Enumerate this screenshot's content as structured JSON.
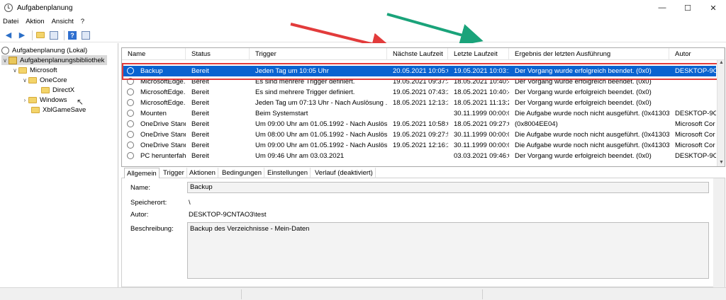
{
  "window": {
    "title": "Aufgabenplanung",
    "controls": [
      "—",
      "☐",
      "✕"
    ]
  },
  "menu": {
    "items": [
      "Datei",
      "Aktion",
      "Ansicht",
      "?"
    ]
  },
  "tree": {
    "items": [
      {
        "label": "Aufgabenplanung (Lokal)",
        "level": 0
      },
      {
        "label": "Aufgabenplanungsbibliothek",
        "level": 0
      },
      {
        "label": "Microsoft",
        "level": 1
      },
      {
        "label": "OneCore",
        "level": 2
      },
      {
        "label": "DirectX",
        "level": 3
      },
      {
        "label": "Windows",
        "level": 2
      },
      {
        "label": "XblGameSave",
        "level": 2
      }
    ]
  },
  "table": {
    "columns": [
      "Name",
      "Status",
      "Trigger",
      "Nächste Laufzeit",
      "Letzte Laufzeit",
      "Ergebnis der letzten Ausführung",
      "Autor"
    ],
    "rows": [
      [
        "Backup",
        "Bereit",
        "Jeden Tag um 10:05 Uhr",
        "20.05.2021 10:05:00",
        "19.05.2021 10:03:12",
        "Der Vorgang wurde erfolgreich beendet. (0x0)",
        "DESKTOP-9CN"
      ],
      [
        "MicrosoftEdge...",
        "Bereit",
        "Es sind mehrere Trigger definiert.",
        "19.05.2021 09:37:30",
        "18.05.2021 10:40:46",
        "Der Vorgang wurde erfolgreich beendet. (0x0)",
        ""
      ],
      [
        "MicrosoftEdge...",
        "Bereit",
        "Es sind mehrere Trigger definiert.",
        "19.05.2021 07:43:22",
        "18.05.2021 10:40:46",
        "Der Vorgang wurde erfolgreich beendet. (0x0)",
        ""
      ],
      [
        "MicrosoftEdge...",
        "Bereit",
        "Jeden Tag um 07:13 Uhr - Nach Auslösung ...",
        "18.05.2021 12:13:23",
        "18.05.2021 11:13:24",
        "Der Vorgang wurde erfolgreich beendet. (0x0)",
        ""
      ],
      [
        "Mounten",
        "Bereit",
        "Beim Systemstart",
        "",
        "30.11.1999 00:00:00",
        "Die Aufgabe wurde noch nicht ausgeführt. (0x41303)",
        "DESKTOP-9CN"
      ],
      [
        "OneDrive Stand...",
        "Bereit",
        "Um 09:00 Uhr am 01.05.1992 - Nach Auslös...",
        "19.05.2021 10:58:02",
        "18.05.2021 09:27:04",
        "(0x8004EE04)",
        "Microsoft Cor"
      ],
      [
        "OneDrive Stand...",
        "Bereit",
        "Um 08:00 Uhr am 01.05.1992 - Nach Auslös...",
        "19.05.2021 09:27:57",
        "30.11.1999 00:00:00",
        "Die Aufgabe wurde noch nicht ausgeführt. (0x41303)",
        "Microsoft Cor"
      ],
      [
        "OneDrive Stand...",
        "Bereit",
        "Um 09:00 Uhr am 01.05.1992 - Nach Auslös...",
        "19.05.2021 12:16:28",
        "30.11.1999 00:00:00",
        "Die Aufgabe wurde noch nicht ausgeführt. (0x41303)",
        "Microsoft Cor"
      ],
      [
        "PC herunterfahr...",
        "Bereit",
        "Um 09:46 Uhr am 03.03.2021",
        "",
        "03.03.2021 09:46:00",
        "Der Vorgang wurde erfolgreich beendet. (0x0)",
        "DESKTOP-9CN"
      ]
    ]
  },
  "tabs": [
    "Allgemein",
    "Trigger",
    "Aktionen",
    "Bedingungen",
    "Einstellungen",
    "Verlauf (deaktiviert)"
  ],
  "detail": {
    "name_label": "Name:",
    "name_value": "Backup",
    "location_label": "Speicherort:",
    "location_value": "\\",
    "author_label": "Autor:",
    "author_value": "DESKTOP-9CNTAO3\\test",
    "description_label": "Beschreibung:",
    "description_value": "Backup des Verzeichnisse - Mein-Daten"
  },
  "colors": {
    "selection": "#0a63d0",
    "highlight_box": "#e23b3b",
    "arrow_red": "#e23b3b",
    "arrow_green": "#1aa37a"
  }
}
